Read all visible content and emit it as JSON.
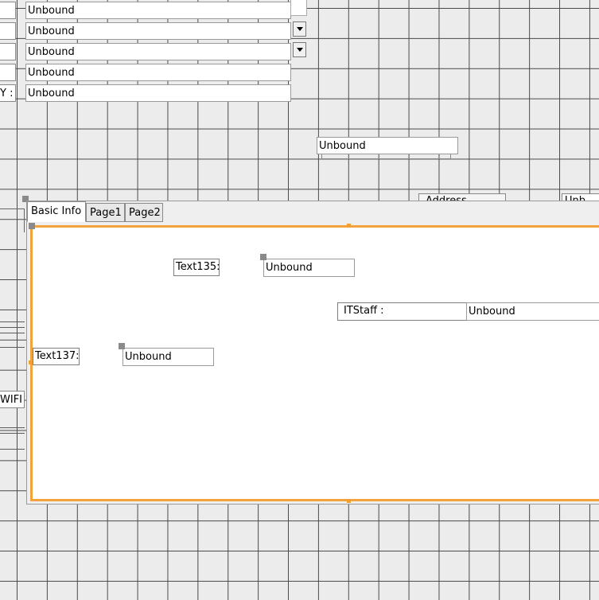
{
  "top_fields": [
    {
      "value": "Unbound"
    },
    {
      "value": "Unbound"
    },
    {
      "value": "Unbound"
    },
    {
      "value": "Unbound"
    },
    {
      "value": "Unbound"
    }
  ],
  "left_labels": {
    "y_label": "Y :",
    "wifi_label": "WIFI :"
  },
  "floating_field": {
    "value": "Unbound"
  },
  "background_partial": {
    "address_label": "Address",
    "right_partial": "Unb"
  },
  "tab_control": {
    "tabs": [
      {
        "label": "Basic Info"
      },
      {
        "label": "Page1"
      },
      {
        "label": "Page2"
      }
    ],
    "text135_label": "Text135:",
    "text135_value": "Unbound",
    "itstaff_label": "ITStaff :",
    "itstaff_value": "Unbound",
    "text137_label": "Text137:",
    "text137_value": "Unbound"
  }
}
